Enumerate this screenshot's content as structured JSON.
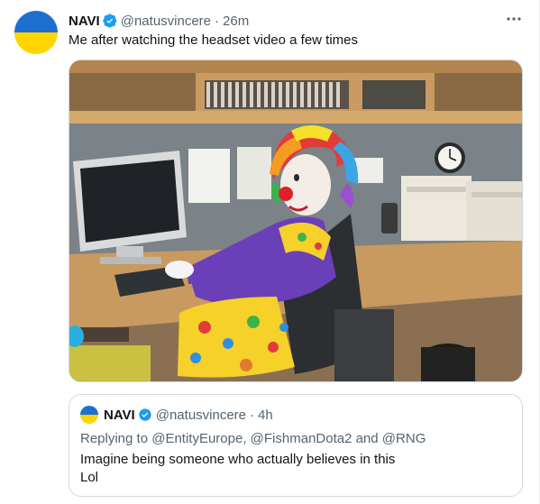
{
  "tweet": {
    "author_name": "NAVI",
    "handle": "@natusvincere",
    "separator": "·",
    "time": "26m",
    "text": "Me after watching the headset video a few times",
    "avatar": "ukraine-flag-avatar",
    "more_icon": "more-horizontal-icon"
  },
  "quote": {
    "author_name": "NAVI",
    "handle": "@natusvincere",
    "separator": "·",
    "time": "4h",
    "reply_prefix": "Replying to",
    "reply_mentions": "@EntityEurope, @FishmanDota2 and @RNG",
    "text": "Imagine being someone who actually believes in this\nLol"
  },
  "colors": {
    "verified": "#1d9bf0",
    "flag_blue": "#1f6fd1",
    "flag_yellow": "#ffd400",
    "secondary_text": "#536471",
    "border": "#cfd9de"
  },
  "icons": {
    "verified_badge": "verified-badge-icon"
  }
}
